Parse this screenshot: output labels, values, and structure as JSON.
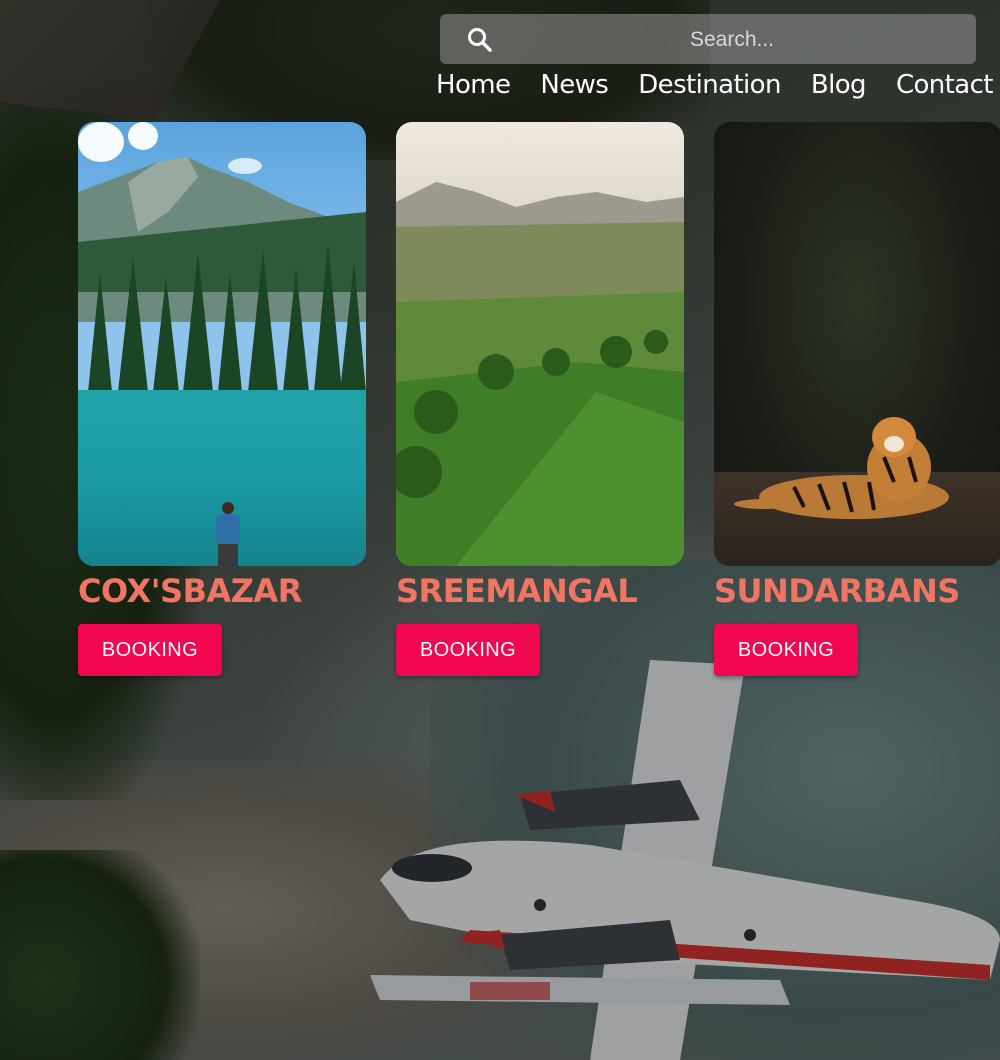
{
  "search": {
    "placeholder": "Search...",
    "icon": "search-icon"
  },
  "nav": {
    "items": [
      {
        "label": "Home"
      },
      {
        "label": "News"
      },
      {
        "label": "Destination"
      },
      {
        "label": "Blog"
      },
      {
        "label": "Contact"
      }
    ]
  },
  "destinations": [
    {
      "title": "COX'SBAZAR",
      "button": "BOOKING"
    },
    {
      "title": "SREEMANGAL",
      "button": "BOOKING"
    },
    {
      "title": "SUNDARBANS",
      "button": "BOOKING"
    }
  ],
  "colors": {
    "title": "#f07563",
    "button": "#f0074f",
    "nav_text": "#ffffff"
  }
}
